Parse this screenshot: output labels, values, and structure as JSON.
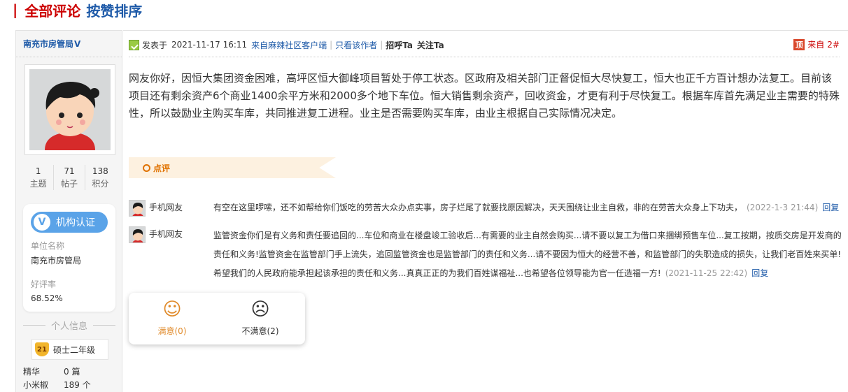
{
  "header": {
    "bar": "|",
    "title_all": "全部评论",
    "title_sort": "按赞排序"
  },
  "user": {
    "name": "南充市房管局",
    "verified_mark": "V",
    "stats": [
      {
        "value": "1",
        "label": "主题"
      },
      {
        "value": "71",
        "label": "帖子"
      },
      {
        "value": "138",
        "label": "积分"
      }
    ],
    "cert": {
      "badge_letter": "V",
      "button_label": "机构认证",
      "unit_label": "单位名称",
      "unit_value": "南充市房管局",
      "rating_label": "好评率",
      "rating_value": "68.52%"
    },
    "personal_info_title": "个人信息",
    "level_num": "21",
    "level_name": "硕士二年级",
    "extra": [
      {
        "key": "精华",
        "value": "0 篇"
      },
      {
        "key": "小米椒",
        "value": "189 个"
      }
    ]
  },
  "post": {
    "posted_prefix": "发表于",
    "posted_time": "2021-11-17 16:11",
    "source": "来自麻辣社区客户端",
    "sep": "|",
    "only_author": "只看该作者",
    "greet": "招呼Ta",
    "follow": "关注Ta",
    "top_icon": "顶",
    "floor_prefix": "来自",
    "floor": "2#",
    "content": "网友你好，因恒大集团资金困难，高坪区恒大御峰项目暂处于停工状态。区政府及相关部门正督促恒大尽快复工，恒大也正千方百计想办法复工。目前该项目还有剩余资产6个商业1400余平方米和2000多个地下车位。恒大销售剩余资产，回收资金，才更有利于尽快复工。根据车库首先满足业主需要的特殊性，所以鼓励业主购买车库，共同推进复工进程。业主是否需要购买车库，由业主根据自己实际情况决定。",
    "review_label": "点评"
  },
  "comments": [
    {
      "author": "手机网友",
      "text": "有空在这里啰嗦，还不如帮给你们饭吃的劳苦大众办点实事，房子烂尾了就要找原因解决，天天围绕让业主自救，非的在劳苦大众身上下功夫，",
      "time": "(2022-1-3 21:44)",
      "reply": "回复"
    },
    {
      "author": "手机网友",
      "text": "监管资金你们是有义务和责任要追回的...车位和商业在楼盘竣工验收后...有需要的业主自然会购买...请不要以复工为借口来捆绑预售车位...复工按期，按质交房是开发商的责任和义务!监管资金在监管部门手上流失，追回监管资金也是监管部门的责任和义务...请不要因为恒大的经营不善，和监管部门的失职造成的损失，让我们老百姓来买单!希望我们的人民政府能承担起该承担的责任和义务...真真正正的为我们百姓谋福祉...也希望各位领导能为官一任造福一方!",
      "time": "(2021-11-25 22:42)",
      "reply": "回复"
    }
  ],
  "rating": {
    "satisfied_label": "满意(0)",
    "unsatisfied_label": "不满意(2)",
    "satisfied_color": "#e08a2a"
  },
  "colors": {
    "accent_red": "#cc0000",
    "link_blue": "#1e5aa8",
    "orange": "#e07200"
  }
}
